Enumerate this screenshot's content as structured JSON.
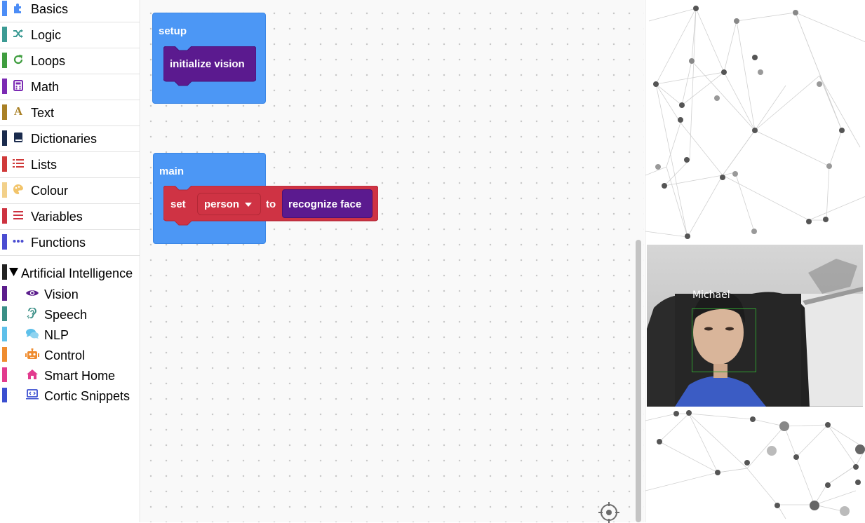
{
  "sidebar": {
    "categories": [
      {
        "label": "Basics",
        "color": "#4c8df6",
        "icon": "puzzle-icon"
      },
      {
        "label": "Logic",
        "color": "#3c9b94",
        "icon": "shuffle-icon"
      },
      {
        "label": "Loops",
        "color": "#3f9d3f",
        "icon": "loop-icon"
      },
      {
        "label": "Math",
        "color": "#7b2ab3",
        "icon": "calculator-icon"
      },
      {
        "label": "Text",
        "color": "#a98025",
        "icon": "text-a-icon"
      },
      {
        "label": "Dictionaries",
        "color": "#1a2b4d",
        "icon": "book-icon"
      },
      {
        "label": "Lists",
        "color": "#d03a3a",
        "icon": "list-icon"
      },
      {
        "label": "Colour",
        "color": "#f2d08a",
        "icon": "palette-icon"
      },
      {
        "label": "Variables",
        "color": "#cd3240",
        "icon": "variables-icon"
      },
      {
        "label": "Functions",
        "color": "#4a4cd1",
        "icon": "dots-icon"
      }
    ],
    "ai_group": {
      "label": "Artificial Intelligence",
      "color": "#222222",
      "items": [
        {
          "label": "Vision",
          "color": "#5b1d8c",
          "icon": "eye-icon"
        },
        {
          "label": "Speech",
          "color": "#3a8f86",
          "icon": "ear-icon"
        },
        {
          "label": "NLP",
          "color": "#5ec0ea",
          "icon": "chat-icon"
        },
        {
          "label": "Control",
          "color": "#ef8c2f",
          "icon": "robot-icon"
        },
        {
          "label": "Smart Home",
          "color": "#e23b8e",
          "icon": "home-icon"
        },
        {
          "label": "Cortic Snippets",
          "color": "#3b4fd0",
          "icon": "laptop-code-icon"
        }
      ]
    }
  },
  "workspace": {
    "setup_block": {
      "label": "setup",
      "inner": "initialize vision"
    },
    "main_block": {
      "label": "main",
      "set_label": "set",
      "variable": "person",
      "to_label": "to",
      "value": "recognize face"
    }
  },
  "camera": {
    "face_name": "Michael"
  },
  "colors": {
    "hat_block": "#4c97f5",
    "vision_block": "#5b1a8f",
    "variables_block": "#cf3344"
  }
}
